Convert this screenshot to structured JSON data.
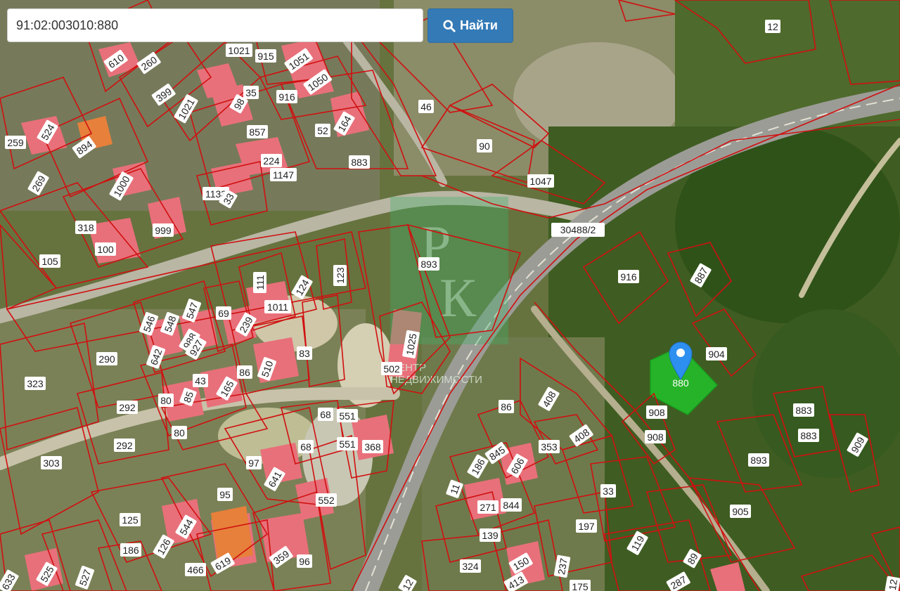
{
  "search": {
    "value": "91:02:003010:880",
    "button_label": "Найти",
    "button_icon": "search-icon"
  },
  "map": {
    "selected_parcel": "880",
    "watermark_line1": "ЦЕНТР",
    "watermark_line2": "НЕДВИЖИМОСТИ",
    "road_label": "30488/2",
    "colors": {
      "boundary": "#d01010",
      "selected_fill": "#22c22a",
      "building": "#e8707a",
      "marker": "#2d8ff0",
      "button": "#337ab7"
    },
    "parcels": [
      {
        "n": "610",
        "rot": -35
      },
      {
        "n": "260",
        "rot": -35
      },
      {
        "n": "1021",
        "rot": 0
      },
      {
        "n": "915",
        "rot": 0
      },
      {
        "n": "1051",
        "rot": -35
      },
      {
        "n": "399",
        "rot": -35
      },
      {
        "n": "1021",
        "rot": -60
      },
      {
        "n": "35",
        "rot": 0
      },
      {
        "n": "98",
        "rot": -60
      },
      {
        "n": "916",
        "rot": 0
      },
      {
        "n": "1050",
        "rot": -35
      },
      {
        "n": "46",
        "rot": 0
      },
      {
        "n": "12",
        "rot": 0
      },
      {
        "n": "259",
        "rot": 0
      },
      {
        "n": "524",
        "rot": -60
      },
      {
        "n": "894",
        "rot": -35
      },
      {
        "n": "857",
        "rot": 0
      },
      {
        "n": "52",
        "rot": 0
      },
      {
        "n": "164",
        "rot": -60
      },
      {
        "n": "90",
        "rot": 0
      },
      {
        "n": "269",
        "rot": -60
      },
      {
        "n": "1000",
        "rot": -60
      },
      {
        "n": "224",
        "rot": 0
      },
      {
        "n": "1147",
        "rot": 0
      },
      {
        "n": "883",
        "rot": 0
      },
      {
        "n": "1047",
        "rot": 0
      },
      {
        "n": "1133",
        "rot": 0
      },
      {
        "n": "33",
        "rot": -60
      },
      {
        "n": "318",
        "rot": 0
      },
      {
        "n": "999",
        "rot": 0
      },
      {
        "n": "30488/2",
        "rot": 0
      },
      {
        "n": "100",
        "rot": 0
      },
      {
        "n": "105",
        "rot": 0
      },
      {
        "n": "893",
        "rot": 0
      },
      {
        "n": "123",
        "rot": -90
      },
      {
        "n": "916",
        "rot": 0
      },
      {
        "n": "887",
        "rot": -60
      },
      {
        "n": "111",
        "rot": -90
      },
      {
        "n": "124",
        "rot": -60
      },
      {
        "n": "1011",
        "rot": 0
      },
      {
        "n": "546",
        "rot": -70
      },
      {
        "n": "548",
        "rot": -70
      },
      {
        "n": "547",
        "rot": -70
      },
      {
        "n": "69",
        "rot": 0
      },
      {
        "n": "239",
        "rot": -60
      },
      {
        "n": "988",
        "rot": -60
      },
      {
        "n": "927",
        "rot": -60
      },
      {
        "n": "642",
        "rot": -70
      },
      {
        "n": "1025",
        "rot": -80
      },
      {
        "n": "290",
        "rot": 0
      },
      {
        "n": "83",
        "rot": 0
      },
      {
        "n": "510",
        "rot": -70
      },
      {
        "n": "904",
        "rot": 0
      },
      {
        "n": "323",
        "rot": 0
      },
      {
        "n": "43",
        "rot": 0
      },
      {
        "n": "165",
        "rot": -60
      },
      {
        "n": "86",
        "rot": 0
      },
      {
        "n": "502",
        "rot": 0
      },
      {
        "n": "80",
        "rot": 0
      },
      {
        "n": "85",
        "rot": -70
      },
      {
        "n": "292",
        "rot": 0
      },
      {
        "n": "86",
        "rot": 0
      },
      {
        "n": "408",
        "rot": -60
      },
      {
        "n": "908",
        "rot": 0
      },
      {
        "n": "883",
        "rot": 0
      },
      {
        "n": "80",
        "rot": 0
      },
      {
        "n": "68",
        "rot": 0
      },
      {
        "n": "551",
        "rot": 0
      },
      {
        "n": "408",
        "rot": -35
      },
      {
        "n": "908",
        "rot": 0
      },
      {
        "n": "883",
        "rot": 0
      },
      {
        "n": "909",
        "rot": -60
      },
      {
        "n": "292",
        "rot": 0
      },
      {
        "n": "68",
        "rot": 0
      },
      {
        "n": "551",
        "rot": 0
      },
      {
        "n": "368",
        "rot": 0
      },
      {
        "n": "353",
        "rot": 0
      },
      {
        "n": "845",
        "rot": -35
      },
      {
        "n": "606",
        "rot": -60
      },
      {
        "n": "303",
        "rot": 0
      },
      {
        "n": "97",
        "rot": 0
      },
      {
        "n": "186",
        "rot": -60
      },
      {
        "n": "893",
        "rot": 0
      },
      {
        "n": "641",
        "rot": -60
      },
      {
        "n": "11",
        "rot": -70
      },
      {
        "n": "95",
        "rot": 0
      },
      {
        "n": "552",
        "rot": 0
      },
      {
        "n": "33",
        "rot": 0
      },
      {
        "n": "271",
        "rot": 0
      },
      {
        "n": "844",
        "rot": 0
      },
      {
        "n": "905",
        "rot": 0
      },
      {
        "n": "125",
        "rot": 0
      },
      {
        "n": "544",
        "rot": -60
      },
      {
        "n": "197",
        "rot": 0
      },
      {
        "n": "126",
        "rot": -60
      },
      {
        "n": "139",
        "rot": 0
      },
      {
        "n": "119",
        "rot": -60
      },
      {
        "n": "186",
        "rot": 0
      },
      {
        "n": "359",
        "rot": -35
      },
      {
        "n": "96",
        "rot": 0
      },
      {
        "n": "89",
        "rot": -60
      },
      {
        "n": "525",
        "rot": -60
      },
      {
        "n": "466",
        "rot": 0
      },
      {
        "n": "619",
        "rot": -30
      },
      {
        "n": "324",
        "rot": 0
      },
      {
        "n": "150",
        "rot": -30
      },
      {
        "n": "237",
        "rot": -80
      },
      {
        "n": "527",
        "rot": -70
      },
      {
        "n": "633",
        "rot": -60
      },
      {
        "n": "413",
        "rot": -30
      },
      {
        "n": "175",
        "rot": 0
      },
      {
        "n": "287",
        "rot": -30
      },
      {
        "n": "12",
        "rot": -60
      },
      {
        "n": "12",
        "rot": -80
      }
    ]
  }
}
